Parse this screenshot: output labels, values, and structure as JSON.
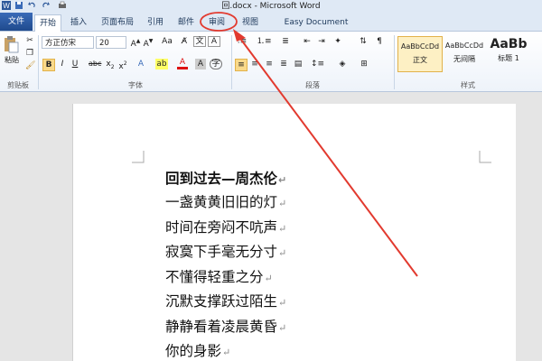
{
  "window": {
    "title": "回.docx - Microsoft Word"
  },
  "tabs": {
    "file": "文件",
    "home": "开始",
    "insert": "插入",
    "layout": "页面布局",
    "references": "引用",
    "mailings": "邮件",
    "review": "审阅",
    "view": "视图",
    "addin": "Easy Document Creator"
  },
  "ribbon": {
    "clipboard": {
      "paste": "粘贴",
      "label": "剪贴板"
    },
    "font": {
      "face": "方正仿宋",
      "size": "20",
      "label": "字体"
    },
    "paragraph": {
      "label": "段落"
    },
    "styles": {
      "label": "样式",
      "items": [
        {
          "sample": "AaBbCcDd",
          "name": "正文"
        },
        {
          "sample": "AaBbCcDd",
          "name": "无间隔"
        },
        {
          "sample": "AaBb",
          "name": "标题 1"
        }
      ]
    }
  },
  "document": {
    "lines": [
      "回到过去—周杰伦",
      "一盏黄黄旧旧的灯",
      "时间在旁闷不吭声",
      "寂寞下手毫无分寸",
      "不懂得轻重之分",
      "沉默支撑跃过陌生",
      "静静看着凌晨黄昏",
      "你的身影"
    ],
    "paragraph_mark": "↵"
  },
  "annotation": {
    "color": "#e23a2f"
  },
  "colors": {
    "file_tab": "#2b579a",
    "ribbon_border": "#b7c7dc"
  }
}
